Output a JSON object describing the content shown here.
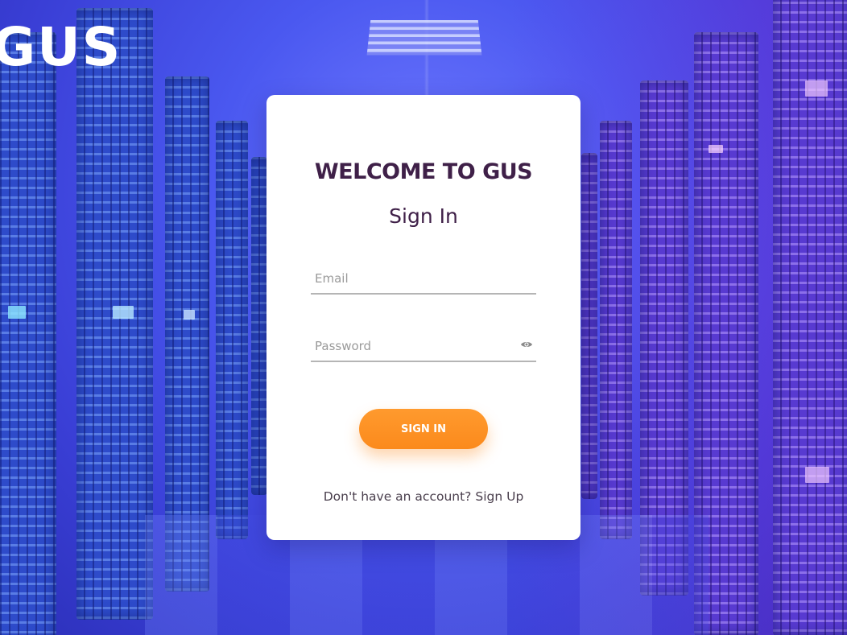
{
  "brand": {
    "logo_text": "GUS"
  },
  "card": {
    "welcome_title": "WELCOME TO GUS",
    "subtitle": "Sign In",
    "email": {
      "placeholder": "Email",
      "value": ""
    },
    "password": {
      "placeholder": "Password",
      "value": "",
      "toggle_icon": "eye-icon"
    },
    "submit_label": "SIGN IN",
    "signup_prompt": "Don't have an account?",
    "signup_link": "Sign Up"
  },
  "colors": {
    "accent": "#fb8a1c",
    "heading": "#3f2048",
    "background_primary": "#4a58f0",
    "background_secondary": "#8a3fe0"
  }
}
